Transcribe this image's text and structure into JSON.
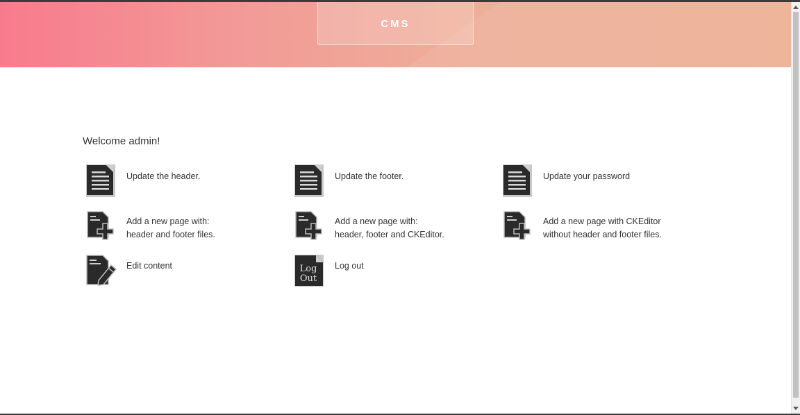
{
  "header": {
    "logo_text": "CMS",
    "gradient_start": "#f87b8d",
    "gradient_end": "#edb094"
  },
  "main": {
    "welcome": "Welcome admin!",
    "actions": [
      {
        "line1": "Update the header.",
        "line2": "",
        "icon": "document-icon"
      },
      {
        "line1": "Update the footer.",
        "line2": "",
        "icon": "document-icon"
      },
      {
        "line1": "Update your password",
        "line2": "",
        "icon": "document-icon"
      },
      {
        "line1": "Add a new page with:",
        "line2": "header and footer files.",
        "icon": "add-page-icon"
      },
      {
        "line1": "Add a new page with:",
        "line2": "header, footer and CKEditor.",
        "icon": "add-page-icon"
      },
      {
        "line1": "Add a new page with CKEditor",
        "line2": "without header and footer files.",
        "icon": "add-page-icon"
      },
      {
        "line1": "Edit content",
        "line2": "",
        "icon": "edit-page-icon"
      },
      {
        "line1": "Log out",
        "line2": "",
        "icon": "logout-icon"
      }
    ],
    "logout_icon_text": {
      "line1": "Log",
      "line2": "Out"
    }
  }
}
